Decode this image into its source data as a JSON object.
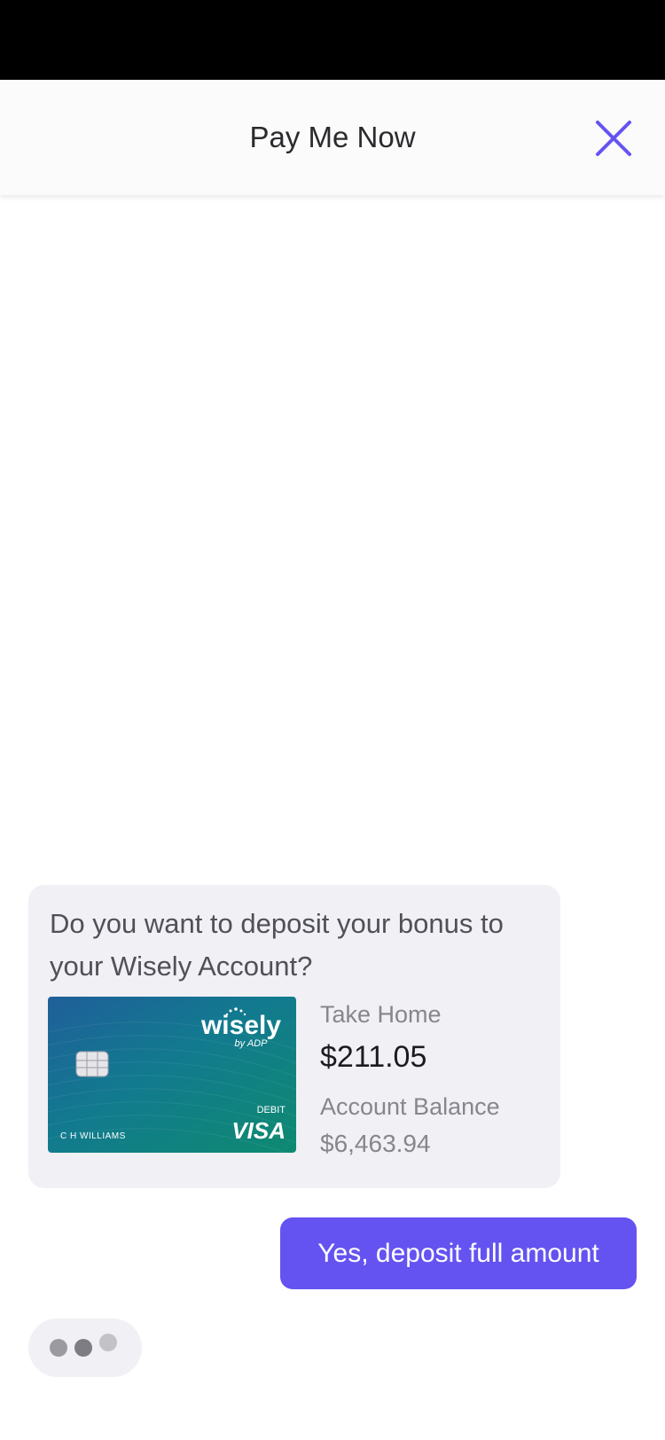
{
  "header": {
    "title": "Pay Me Now",
    "close_icon": "close-icon",
    "accent_color": "#6453f1"
  },
  "chat": {
    "bot_message": {
      "text": "Do you want to deposit your bonus to your Wisely Account?",
      "card": {
        "brand": "wisely",
        "brand_sub": "by ADP",
        "cardholder": "C H WILLIAMS",
        "card_type": "DEBIT",
        "network": "VISA"
      },
      "take_home_label": "Take Home",
      "take_home_value": "$211.05",
      "balance_label": "Account Balance",
      "balance_value": "$6,463.94"
    },
    "user_reply": "Yes, deposit full amount",
    "typing_indicator": "typing-dots"
  }
}
